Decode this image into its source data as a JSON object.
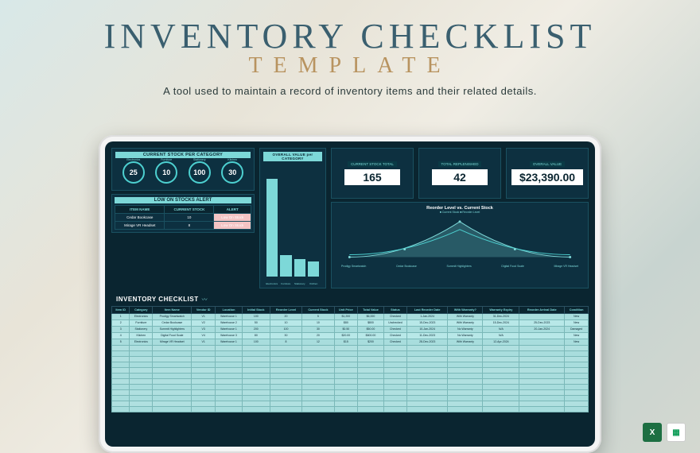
{
  "title_main": "INVENTORY CHECKLIST",
  "title_sub": "TEMPLATE",
  "subtitle": "A tool used to maintain a record of inventory items and their related details.",
  "stock_cat": {
    "title": "CURRENT STOCK PER CATEGORY",
    "items": [
      {
        "label": "Electronics",
        "value": "25"
      },
      {
        "label": "Furniture",
        "value": "10"
      },
      {
        "label": "Stationery",
        "value": "100"
      },
      {
        "label": "Kitchen",
        "value": "30"
      }
    ]
  },
  "low_stock": {
    "title": "LOW ON STOCKS ALERT",
    "headers": [
      "ITEM NAME",
      "CURRENT STOCK",
      "ALERT"
    ],
    "rows": [
      {
        "name": "Cedar Bookcase",
        "stock": "10",
        "alert": "Low On Stock"
      },
      {
        "name": "Mirage VR Headset",
        "stock": "8",
        "alert": "Low On Stock"
      }
    ]
  },
  "bar_panel": {
    "title": "OVERALL VALUE per CATEGORY",
    "labels": [
      "Electronics",
      "Furniture",
      "Stationery",
      "Kitchen"
    ]
  },
  "kpis": [
    {
      "label": "CURRENT STOCK TOTAL",
      "value": "165"
    },
    {
      "label": "TOTAL REPLENISHED",
      "value": "42"
    },
    {
      "label": "OVERALL VALUE",
      "value": "$23,390.00"
    }
  ],
  "curve": {
    "title": "Reorder Level vs. Current Stock",
    "legend": "■ Current Stock  ■ Reorder Level",
    "labels": [
      "Prodigy Smartwatch",
      "Cedar Bookcase",
      "Summit Highlighters",
      "Digital Food Scale",
      "Mirage VR Headset"
    ]
  },
  "inventory": {
    "title": "INVENTORY CHECKLIST",
    "headers": [
      "Item ID",
      "Category",
      "Item Name",
      "Vendor ID",
      "Location",
      "Initial Stock",
      "Reorder Level",
      "Current Stock",
      "Unit Price",
      "Total Value",
      "Status",
      "Last Reorder Date",
      "With Warranty?",
      "Warranty Expiry",
      "Reorder Arrival Date",
      "Condition"
    ],
    "rows": [
      [
        "1",
        "Electronics",
        "Prodigy Smartwatch",
        "V1",
        "Warehouse 1",
        "100",
        "20",
        "5",
        "$1,200",
        "$6,000",
        "Checked",
        "1-Jan-2024",
        "With Warranty",
        "31-Dec-2024",
        "",
        "New"
      ],
      [
        "2",
        "Furniture",
        "Cedar Bookcase",
        "V2",
        "Warehouse 2",
        "50",
        "10",
        "10",
        "$80",
        "$800",
        "Unchecked",
        "15-Dec-2023",
        "With Warranty",
        "15-Dec-2024",
        "25-Dec-2023",
        "New"
      ],
      [
        "3",
        "Stationery",
        "Summit Highlighters",
        "V3",
        "Warehouse 1",
        "200",
        "100",
        "30",
        "$0.50",
        "$50.00",
        "Checked",
        "10-Jan-2024",
        "No Warranty",
        "N/A",
        "20-Jan-2024",
        "Damaged"
      ],
      [
        "4",
        "Kitchen",
        "Digital Food Scale",
        "V4",
        "Warehouse 3",
        "80",
        "30",
        "20",
        "$20.00",
        "$600.00",
        "Checked",
        "11-Dec-2023",
        "No Warranty",
        "N/A",
        "",
        "New"
      ],
      [
        "5",
        "Electronics",
        "Mirage VR Headset",
        "V1",
        "Warehouse 1",
        "100",
        "8",
        "12",
        "$15",
        "$200",
        "Checked",
        "28-Dec-2023",
        "With Warranty",
        "12-Apr-2024",
        "",
        "New"
      ]
    ]
  },
  "formats": {
    "excel": "X",
    "sheets": "▦"
  }
}
